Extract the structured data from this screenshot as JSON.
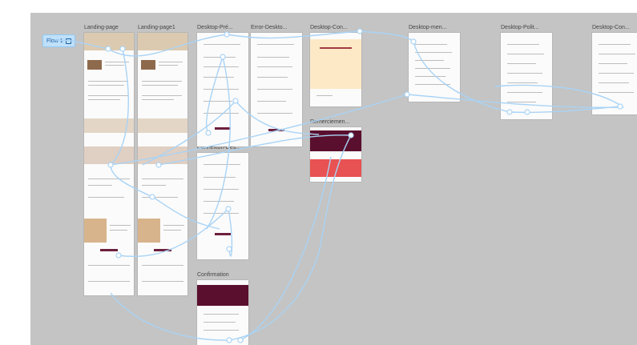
{
  "flow": {
    "label": "Flow 1",
    "icon": "play-frame-icon"
  },
  "frames": [
    {
      "name": "Landing-page"
    },
    {
      "name": "Landing-page1"
    },
    {
      "name": "Desktop-Pré..."
    },
    {
      "name": "Error-Deskto..."
    },
    {
      "name": "Desktop-Con..."
    },
    {
      "name": "Desktop-men..."
    },
    {
      "name": "Desktop-Polit..."
    },
    {
      "name": "Desktop-Con..."
    },
    {
      "name": "Remerciemen..."
    },
    {
      "name": "Connexion-Des..."
    },
    {
      "name": "Confirmation"
    }
  ],
  "colors": {
    "canvas": "#c4c4c4",
    "flow_link": "#a9d3f5",
    "brand_dark": "#5a0f2e",
    "brand_red": "#e85252",
    "cream": "#fde9c6"
  }
}
